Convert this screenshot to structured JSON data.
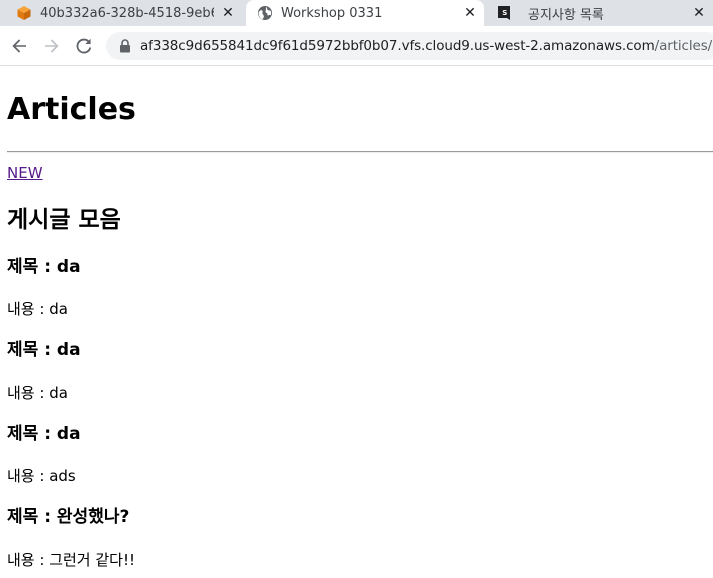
{
  "browser": {
    "tabs": [
      {
        "title": "40b332a6-328b-4518-9eb6",
        "icon": "aws-cube-icon",
        "active": false
      },
      {
        "title": "Workshop 0331",
        "icon": "globe-icon",
        "active": true
      },
      {
        "title": "공지사항 목록",
        "icon": "bookmark-s-icon",
        "active": false
      }
    ],
    "close_glyph": "✕",
    "url_host": "af338c9d655841dc9f61d5972bbf0b07.vfs.cloud9.us-west-2.amazonaws.com",
    "url_path": "/articles/",
    "colors": {
      "tabstrip": "#dee1e6",
      "omnibox": "#f1f3f4",
      "aws_orange": "#f28b20"
    }
  },
  "page": {
    "heading": "Articles",
    "new_link": "NEW",
    "section_title": "게시글 모음",
    "title_prefix": "제목 : ",
    "content_prefix": "내용 : ",
    "articles": [
      {
        "title": "da",
        "content": "da"
      },
      {
        "title": "da",
        "content": "da"
      },
      {
        "title": "da",
        "content": "ads"
      },
      {
        "title": "완성했나?",
        "content": "그런거 같다!!"
      }
    ]
  }
}
